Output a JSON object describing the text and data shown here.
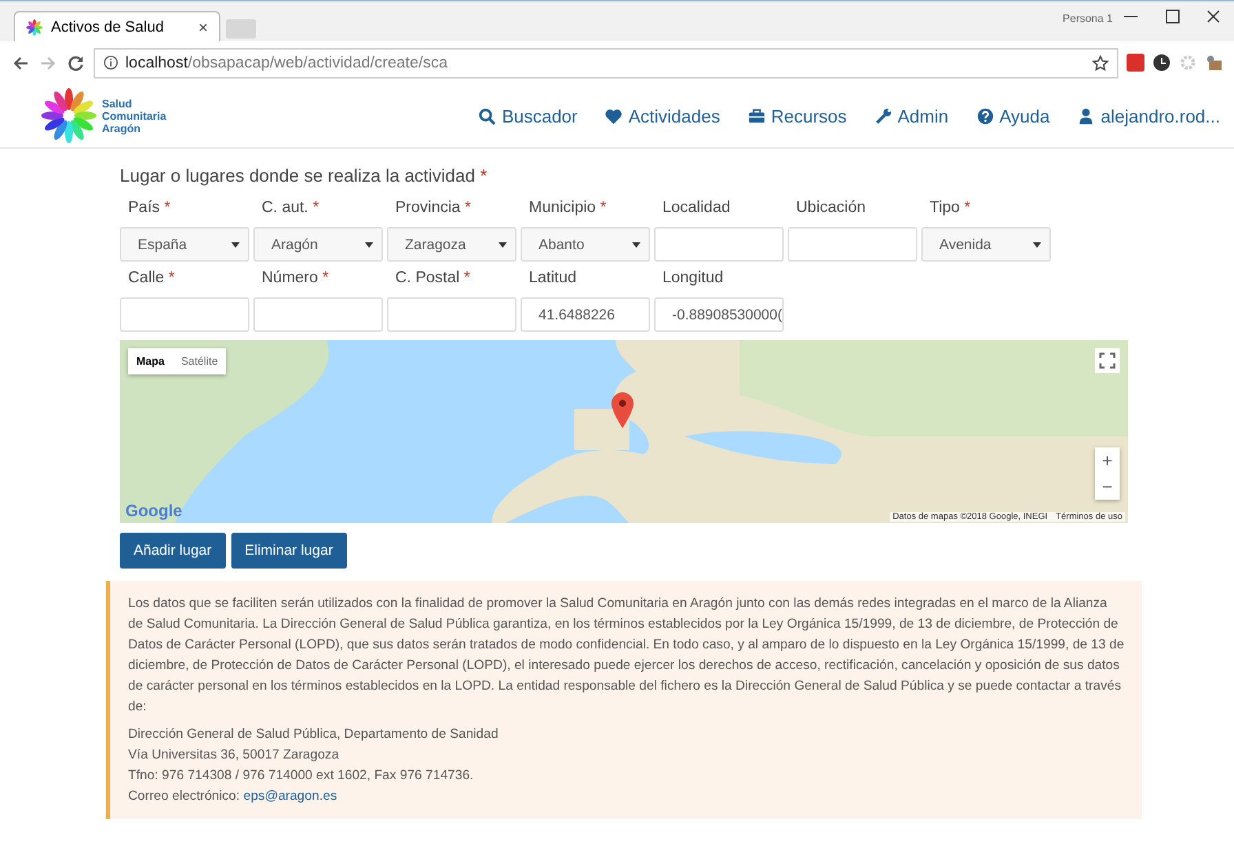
{
  "browser": {
    "tab_title": "Activos de Salud",
    "close": "×",
    "url_host": "localhost",
    "url_path": "/obsapacap/web/actividad/create/sca",
    "profile": "Persona 1"
  },
  "nav": {
    "brand": [
      "Salud",
      "Comunitaria",
      "Aragón"
    ],
    "items": [
      {
        "label": "Buscador",
        "kind": "search"
      },
      {
        "label": "Actividades",
        "kind": "heart"
      },
      {
        "label": "Recursos",
        "kind": "briefcase"
      },
      {
        "label": "Admin",
        "kind": "wrench"
      },
      {
        "label": "Ayuda",
        "kind": "help"
      },
      {
        "label": "alejandro.rod...",
        "kind": "user"
      }
    ]
  },
  "form": {
    "heading": "Lugar o lugares donde se realiza la actividad",
    "heading_mark": "*",
    "rows": [
      [
        {
          "label": "País",
          "mark": "*",
          "kind": "select",
          "value": "España"
        },
        {
          "label": "C. aut.",
          "mark": "*",
          "kind": "select",
          "value": "Aragón"
        },
        {
          "label": "Provincia",
          "mark": "*",
          "kind": "select",
          "value": "Zaragoza"
        },
        {
          "label": "Municipio",
          "mark": "*",
          "kind": "select",
          "value": "Abanto"
        },
        {
          "label": "Localidad",
          "kind": "text"
        },
        {
          "label": "Ubicación",
          "kind": "text"
        },
        {
          "label": "Tipo",
          "mark": "*",
          "kind": "select",
          "value": "Avenida"
        }
      ],
      [
        {
          "label": "Calle",
          "mark": "*",
          "kind": "text"
        },
        {
          "label": "Número",
          "mark": "*",
          "kind": "text"
        },
        {
          "label": "C. Postal",
          "mark": "*",
          "kind": "text"
        },
        {
          "label": "Latitud",
          "kind": "text",
          "value": "41.6488226"
        },
        {
          "label": "Longitud",
          "kind": "text",
          "value": "-0.88908530000("
        }
      ]
    ]
  },
  "map": {
    "types": [
      {
        "label": "Mapa",
        "selected": true
      },
      {
        "label": "Satélite",
        "selected": false
      }
    ],
    "logo": "Google",
    "attribution": "Datos de mapas ©2018 Google, INEGI",
    "terms": "Términos de uso",
    "zoom_in": "+",
    "zoom_out": "−"
  },
  "buttons": [
    "Añadir lugar",
    "Eliminar lugar"
  ],
  "notice": {
    "paragraph": "Los datos que se faciliten serán utilizados con la finalidad de promover la Salud Comunitaria en Aragón junto con las demás redes integradas en el marco de la Alianza de Salud Comunitaria. La Dirección General de Salud Pública garantiza, en los términos establecidos por la Ley Orgánica 15/1999, de 13 de diciembre, de Protección de Datos de Carácter Personal (LOPD), que sus datos serán tratados de modo confidencial. En todo caso, y al amparo de lo dispuesto en la Ley Orgánica 15/1999, de 13 de diciembre, de Protección de Datos de Carácter Personal (LOPD), el interesado puede ejercer los derechos de acceso, rectificación, cancelación y oposición de sus datos de carácter personal en los términos establecidos en la LOPD. La entidad responsable del fichero es la Dirección General de Salud Pública y se puede contactar a través de:",
    "contact_lines": [
      "Dirección General de Salud Pública, Departamento de Sanidad",
      "Vía Universitas 36, 50017 Zaragoza",
      "Tfno: 976 714308 / 976 714000 ext 1602, Fax 976 714736."
    ],
    "email_label": "Correo electrónico:",
    "email": "eps@aragon.es"
  }
}
